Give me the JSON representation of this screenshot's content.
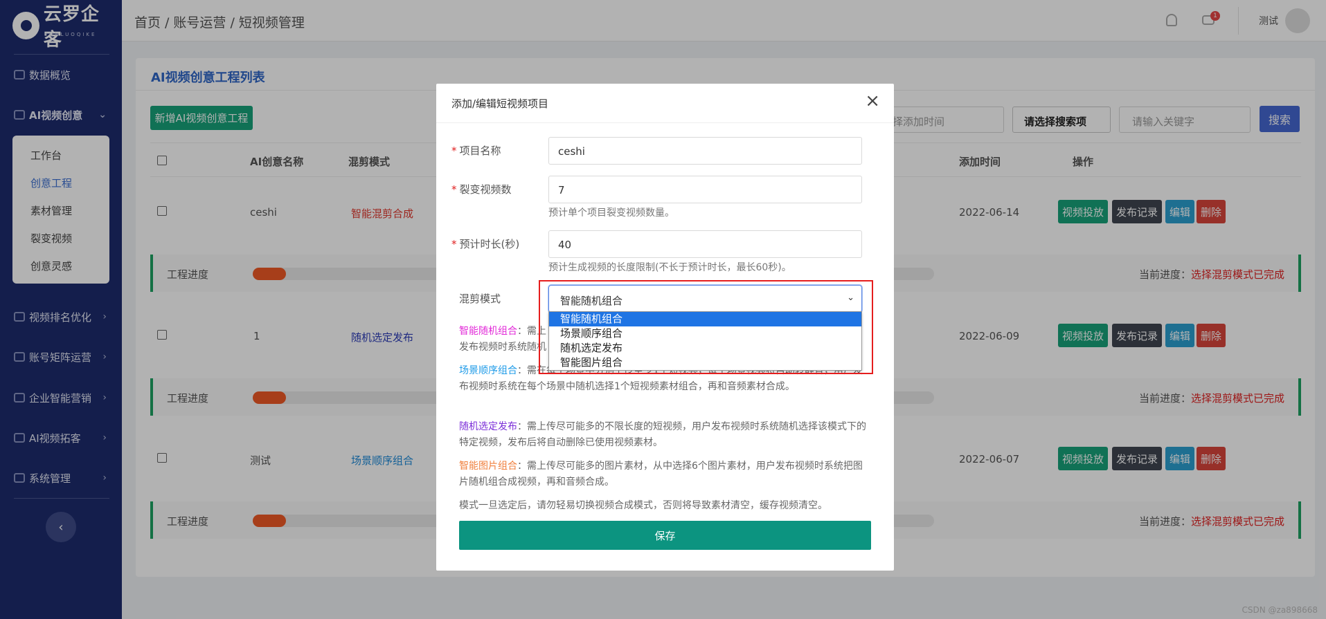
{
  "brand": {
    "name": "云罗企客",
    "sub": "YUNLUOQIKE"
  },
  "sidebar": {
    "items": [
      {
        "label": "数据概览"
      },
      {
        "label": "AI视频创意"
      },
      {
        "label": "视频排名优化"
      },
      {
        "label": "账号矩阵运营"
      },
      {
        "label": "企业智能营销"
      },
      {
        "label": "AI视频拓客"
      },
      {
        "label": "系统管理"
      }
    ],
    "sub_items": [
      {
        "label": "工作台"
      },
      {
        "label": "创意工程"
      },
      {
        "label": "素材管理"
      },
      {
        "label": "裂变视频"
      },
      {
        "label": "创意灵感"
      }
    ],
    "collapse_icon": "chevron-left-icon"
  },
  "header": {
    "breadcrumb": [
      "首页",
      "账号运营",
      "短视频管理"
    ],
    "separator": "/",
    "msg_badge": "1",
    "user_name": "测试"
  },
  "card": {
    "title": "AI视频创意工程列表",
    "add_button": "新增AI视频创意工程",
    "date_placeholder": "择添加时间",
    "search_select": "请选择搜索项",
    "keyword_placeholder": "请输入关键字",
    "search_button": "搜索"
  },
  "table": {
    "headers": {
      "name": "AI创意名称",
      "mode": "混剪模式",
      "time": "添加时间",
      "ops": "操作"
    },
    "rows": [
      {
        "name": "ceshi",
        "mode": "智能混剪合成",
        "mode_color": "#e0352b",
        "time": "2022-06-14"
      },
      {
        "name": "1",
        "mode": "随机选定发布",
        "mode_color": "#2c3bb8",
        "time": "2022-06-09"
      },
      {
        "name": "测试",
        "mode": "场景顺序组合",
        "mode_color": "#1e8ad8",
        "time": "2022-06-07"
      }
    ],
    "ops": {
      "deliver": "视频投放",
      "records": "发布记录",
      "edit": "编辑",
      "delete": "删除"
    },
    "progress": {
      "label": "工程进度",
      "status_prefix": "当前进度：",
      "status_value": "选择混剪模式已完成"
    }
  },
  "modal": {
    "title": "添加/编辑短视频项目",
    "close_icon": "close-icon",
    "fields": {
      "project_name": {
        "label": "项目名称",
        "value": "ceshi"
      },
      "fission_count": {
        "label": "裂变视频数",
        "value": "7",
        "help": "预计单个项目裂变视频数量。"
      },
      "duration": {
        "label": "预计时长(秒)",
        "value": "40",
        "help": "预计生成视频的长度限制(不长于预计时长，最长60秒)。"
      },
      "mix_mode": {
        "label": "混剪模式",
        "value": "智能随机组合",
        "options": [
          "智能随机组合",
          "场景顺序组合",
          "随机选定发布",
          "智能图片组合"
        ]
      }
    },
    "desc": {
      "d1_key": "智能随机组合",
      "d1_text": "：需上",
      "d1_text2": "发布视频时系统随机",
      "d2_key": "场景顺序组合",
      "d2_text": "：需在每个场景中分别上传至少1个短视频，每个场景视频将自动",
      "d2_text2": "转静音，用户发布视频时系统在每个场景中随机选择1个短视频素材组合，再和音频素材合成。",
      "d3_key": "随机选定发布",
      "d3_text": "：需上传尽可能多的不限长度的短视频，用户发布视频时系统随机选择该模式下的特定视频，发布后将自动删除已使用视频素材。",
      "d4_key": "智能图片组合",
      "d4_text": "：需上传尽可能多的图片素材，从中选择6个图片素材，用户发布视频时系统把图片随机组合成视频，再和音频合成。",
      "note": "模式一旦选定后，请勿轻易切换视频合成模式，否则将导致素材清空，缓存视频清空。"
    },
    "save_button": "保存"
  },
  "watermark": "CSDN @za898668"
}
